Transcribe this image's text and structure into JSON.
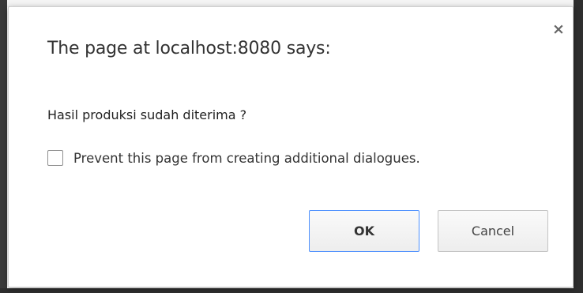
{
  "dialog": {
    "title": "The page at localhost:8080 says:",
    "message": "Hasil produksi sudah diterima ?",
    "suppress_label": "Prevent this page from creating additional dialogues.",
    "suppress_checked": false,
    "close_glyph": "×",
    "ok_label": "OK",
    "cancel_label": "Cancel",
    "icons": {
      "close": "close-icon"
    },
    "colors": {
      "focus_border": "#4d90fe"
    }
  }
}
